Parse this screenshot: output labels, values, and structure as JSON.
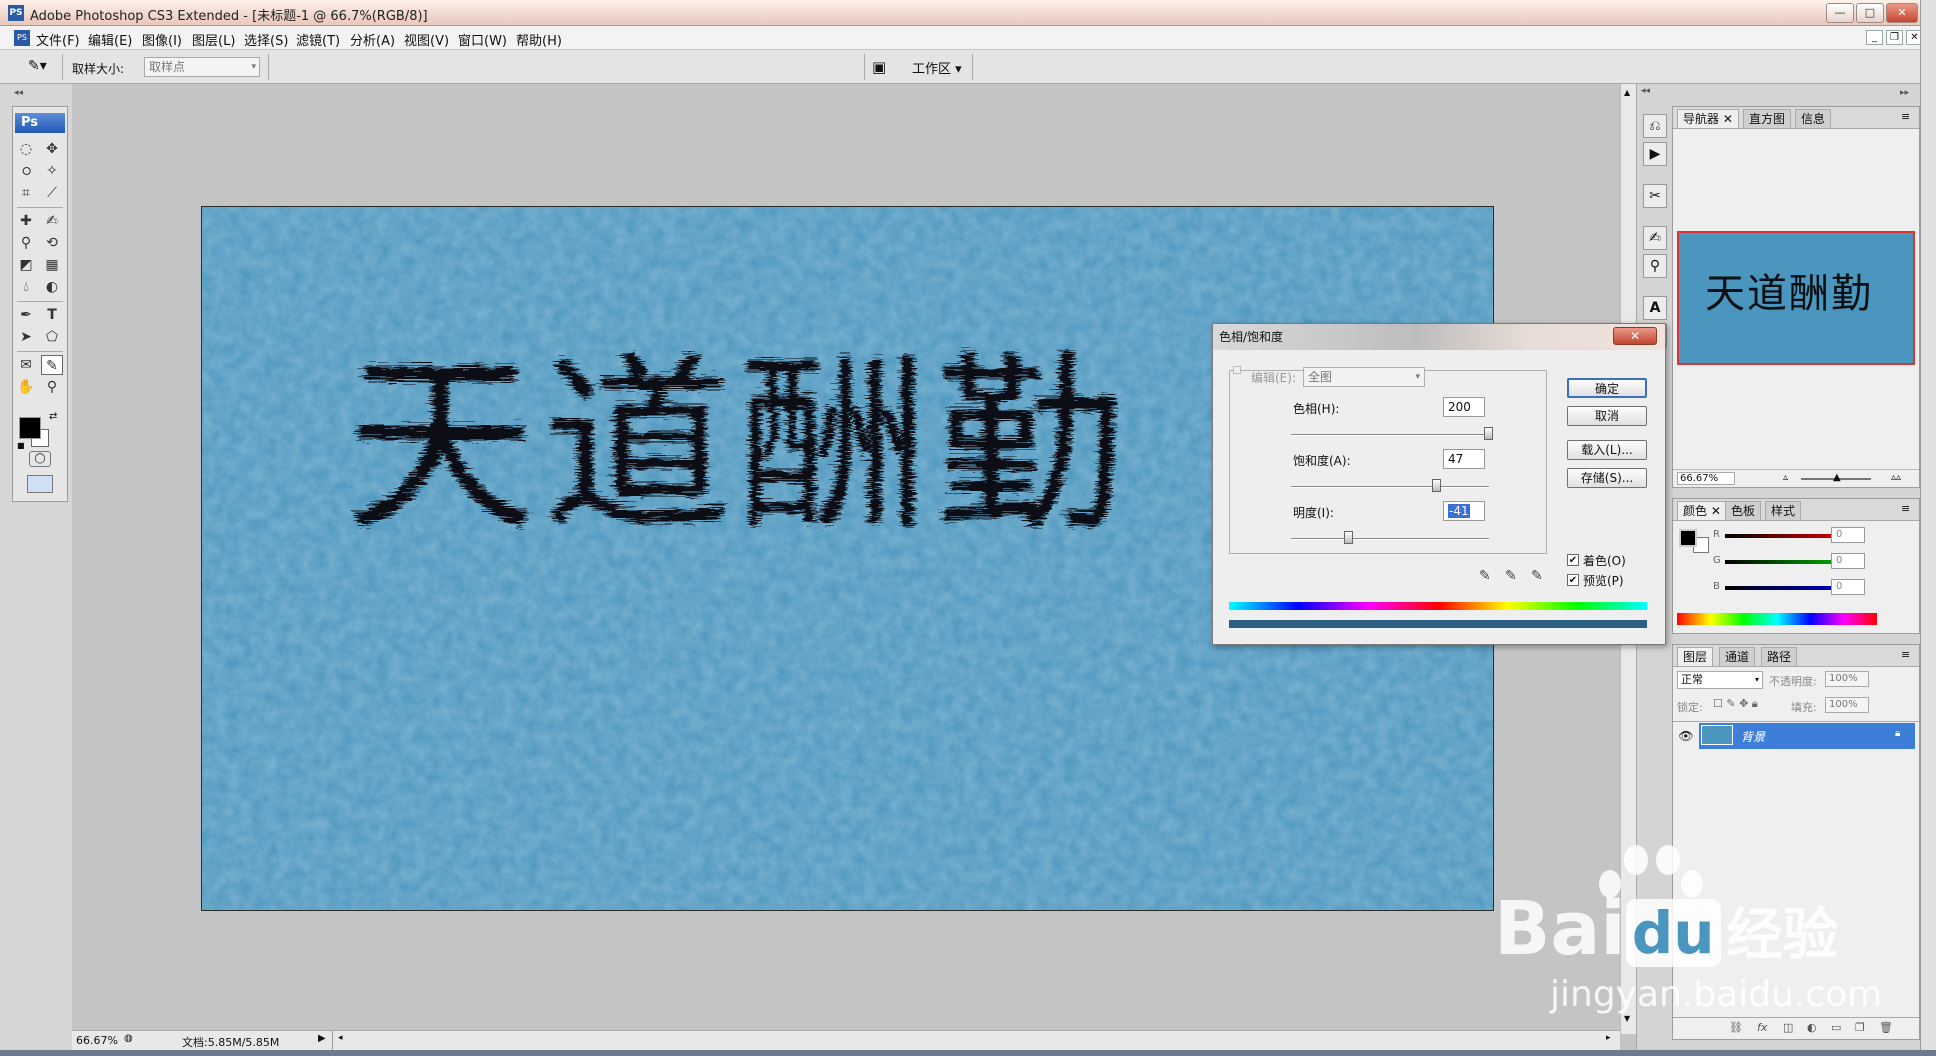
{
  "window": {
    "title": "Adobe Photoshop CS3 Extended - [未标题-1 @ 66.7%(RGB/8)]",
    "app_icon": "PS",
    "btn_min": "—",
    "btn_max": "□",
    "btn_close": "✕"
  },
  "menu": {
    "items": [
      "文件(F)",
      "编辑(E)",
      "图像(I)",
      "图层(L)",
      "选择(S)",
      "滤镜(T)",
      "分析(A)",
      "视图(V)",
      "窗口(W)",
      "帮助(H)"
    ],
    "doc_min": "_",
    "doc_restore": "❐",
    "doc_close": "✕"
  },
  "options": {
    "sample_size_label": "取样大小:",
    "sample_size_value": "取样点",
    "workspace_label": "工作区"
  },
  "tools": {
    "logo": "Ps"
  },
  "canvas": {
    "text": "天道酬勤",
    "bg_color": "#4b96be"
  },
  "status": {
    "zoom": "66.67%",
    "doc_info": "文档:5.85M/5.85M"
  },
  "navigator": {
    "tabs": [
      "导航器",
      "直方图",
      "信息"
    ],
    "zoom": "66.67%",
    "preview_text": "天道酬勤"
  },
  "color_panel": {
    "tabs": [
      "颜色",
      "色板",
      "样式"
    ],
    "r_label": "R",
    "g_label": "G",
    "b_label": "B",
    "r_value": "0",
    "g_value": "0",
    "b_value": "0"
  },
  "layers_panel": {
    "tabs": [
      "图层",
      "通道",
      "路径"
    ],
    "blend_mode": "正常",
    "opacity_label": "不透明度:",
    "opacity_value": "100%",
    "lock_label": "锁定:",
    "fill_label": "填充:",
    "fill_value": "100%",
    "layer_name": "背景"
  },
  "dialog": {
    "title": "色相/饱和度",
    "edit_label": "编辑(E):",
    "edit_value": "全图",
    "hue_label": "色相(H):",
    "hue_value": "200",
    "hue": 200,
    "saturation_label": "饱和度(A):",
    "saturation_value": "47",
    "saturation": 47,
    "lightness_label": "明度(I):",
    "lightness_value": "-41",
    "lightness": -41,
    "ok": "确定",
    "cancel": "取消",
    "load": "载入(L)...",
    "save": "存储(S)...",
    "colorize_label": "着色(O)",
    "colorize": true,
    "preview_label": "预览(P)",
    "preview": true
  },
  "watermark": {
    "brand": "Bai",
    "brand_suffix": "经验",
    "url": "jingyan.baidu.com"
  }
}
